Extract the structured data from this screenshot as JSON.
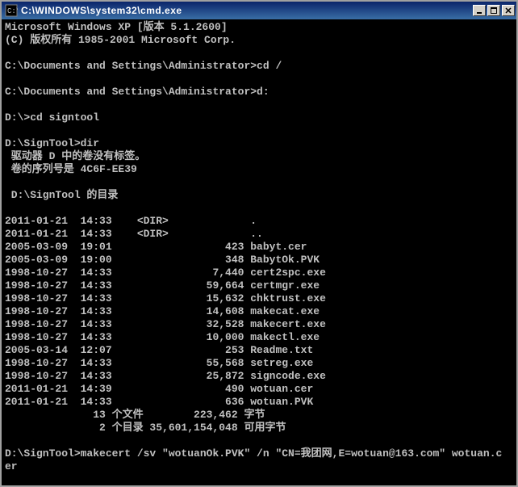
{
  "titlebar": {
    "title": "C:\\WINDOWS\\system32\\cmd.exe"
  },
  "console": {
    "banner1": "Microsoft Windows XP [版本 5.1.2600]",
    "banner2": "(C) 版权所有 1985-2001 Microsoft Corp.",
    "prompt1_prefix": "C:\\Documents and Settings\\Administrator>",
    "cmd1": "cd /",
    "prompt2_prefix": "C:\\Documents and Settings\\Administrator>",
    "cmd2": "d:",
    "prompt3_prefix": "D:\\>",
    "cmd3": "cd signtool",
    "prompt4_prefix": "D:\\SignTool>",
    "cmd4": "dir",
    "dir_header1": " 驱动器 D 中的卷没有标签。",
    "dir_header2": " 卷的序列号是 4C6F-EE39",
    "dir_path_line": " D:\\SignTool 的目录",
    "dir_entries": [
      {
        "date": "2011-01-21",
        "time": "14:33",
        "dir": true,
        "size": "",
        "name": "."
      },
      {
        "date": "2011-01-21",
        "time": "14:33",
        "dir": true,
        "size": "",
        "name": ".."
      },
      {
        "date": "2005-03-09",
        "time": "19:01",
        "dir": false,
        "size": "423",
        "name": "babyt.cer"
      },
      {
        "date": "2005-03-09",
        "time": "19:00",
        "dir": false,
        "size": "348",
        "name": "BabytOk.PVK"
      },
      {
        "date": "1998-10-27",
        "time": "14:33",
        "dir": false,
        "size": "7,440",
        "name": "cert2spc.exe"
      },
      {
        "date": "1998-10-27",
        "time": "14:33",
        "dir": false,
        "size": "59,664",
        "name": "certmgr.exe"
      },
      {
        "date": "1998-10-27",
        "time": "14:33",
        "dir": false,
        "size": "15,632",
        "name": "chktrust.exe"
      },
      {
        "date": "1998-10-27",
        "time": "14:33",
        "dir": false,
        "size": "14,608",
        "name": "makecat.exe"
      },
      {
        "date": "1998-10-27",
        "time": "14:33",
        "dir": false,
        "size": "32,528",
        "name": "makecert.exe"
      },
      {
        "date": "1998-10-27",
        "time": "14:33",
        "dir": false,
        "size": "10,000",
        "name": "makectl.exe"
      },
      {
        "date": "2005-03-14",
        "time": "12:07",
        "dir": false,
        "size": "253",
        "name": "Readme.txt"
      },
      {
        "date": "1998-10-27",
        "time": "14:33",
        "dir": false,
        "size": "55,568",
        "name": "setreg.exe"
      },
      {
        "date": "1998-10-27",
        "time": "14:33",
        "dir": false,
        "size": "25,872",
        "name": "signcode.exe"
      },
      {
        "date": "2011-01-21",
        "time": "14:39",
        "dir": false,
        "size": "490",
        "name": "wotuan.cer"
      },
      {
        "date": "2011-01-21",
        "time": "14:33",
        "dir": false,
        "size": "636",
        "name": "wotuan.PVK"
      }
    ],
    "summary_files": "              13 个文件        223,462 字节",
    "summary_dirs": "               2 个目录 35,601,154,048 可用字节",
    "prompt5_prefix": "D:\\SignTool>",
    "cmd5_line1": "makecert /sv \"wotuanOk.PVK\" /n \"CN=我团网,E=wotuan@163.com\" wotuan.c",
    "cmd5_line2": "er"
  }
}
